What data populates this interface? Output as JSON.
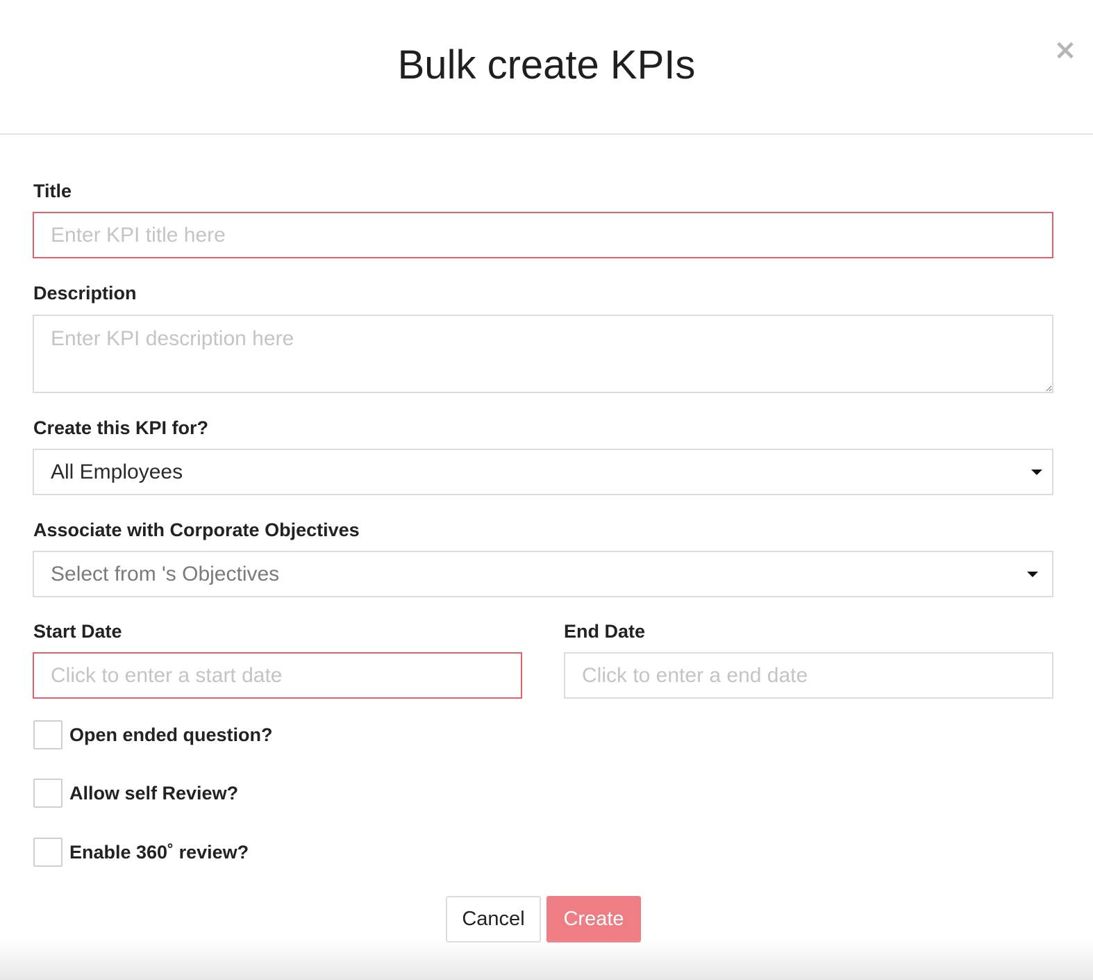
{
  "modal": {
    "title": "Bulk create KPIs",
    "close_glyph": "×"
  },
  "form": {
    "title_label": "Title",
    "title_placeholder": "Enter KPI title here",
    "description_label": "Description",
    "description_placeholder": "Enter KPI description here",
    "create_for_label": "Create this KPI for?",
    "create_for_value": "All Employees",
    "objectives_label": "Associate with Corporate Objectives",
    "objectives_placeholder": "Select from 's Objectives",
    "start_date_label": "Start Date",
    "start_date_placeholder": "Click to enter a start date",
    "end_date_label": "End Date",
    "end_date_placeholder": "Click to enter a end date",
    "checkboxes": [
      {
        "label": "Open ended question?",
        "checked": false
      },
      {
        "label": "Allow self Review?",
        "checked": false
      },
      {
        "label": "Enable 360˚ review?",
        "checked": false
      }
    ]
  },
  "footer": {
    "cancel_label": "Cancel",
    "create_label": "Create"
  },
  "colors": {
    "accent": "#ee7d84",
    "invalid_border": "#e0606b",
    "border": "#dcdcdc"
  }
}
